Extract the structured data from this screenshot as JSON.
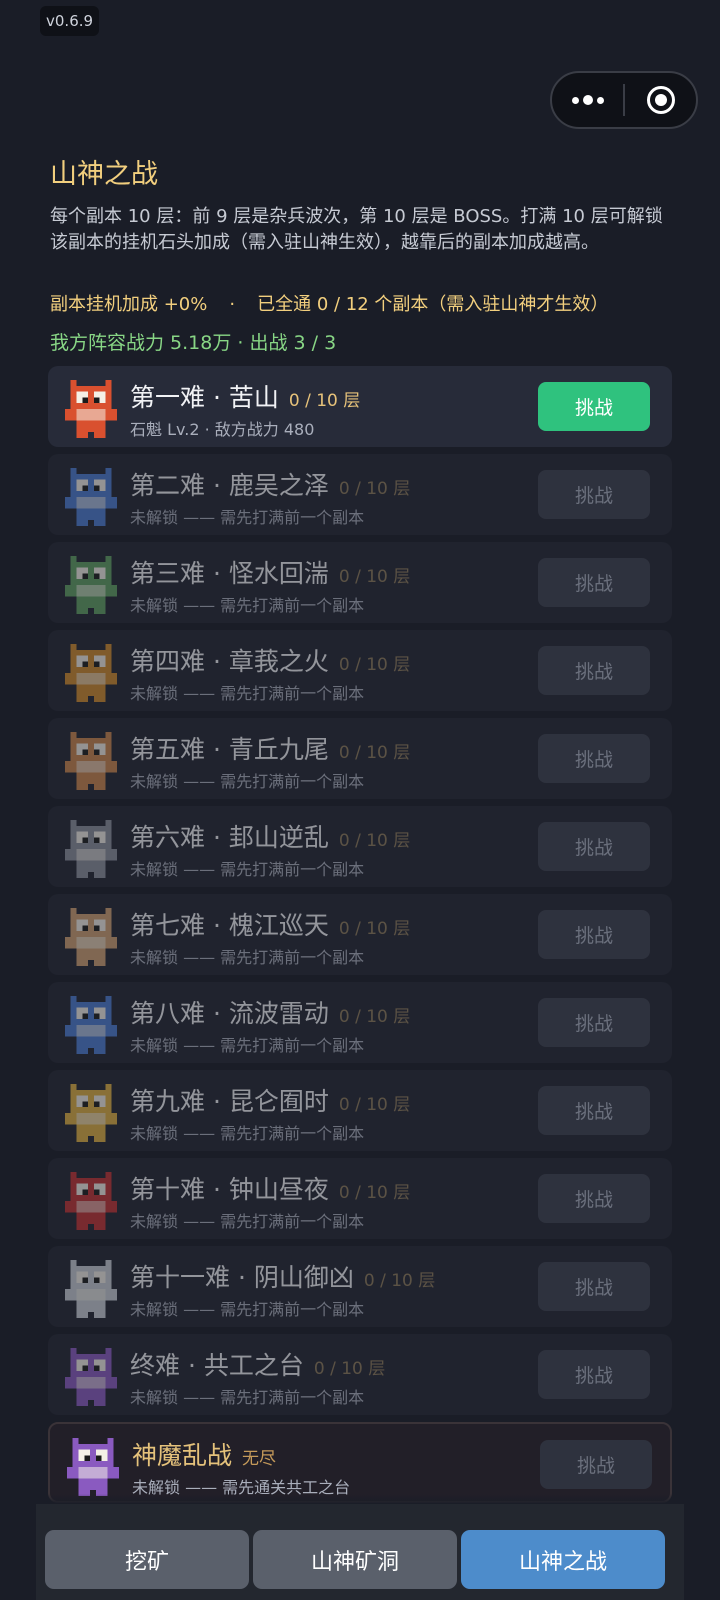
{
  "version": "v0.6.9",
  "capsule": {
    "menu_icon": "more-dots-icon",
    "close_icon": "target-circle-icon"
  },
  "header": {
    "title": "山神之战",
    "description": "每个副本 10 层：前 9 层是杂兵波次，第 10 层是 BOSS。打满 10 层可解锁该副本的挂机石头加成（需入驻山神生效），越靠后的副本加成越高。",
    "bonus_left": "副本挂机加成 +0%",
    "bonus_dot": "·",
    "bonus_right": "已全通 0 / 12 个副本（需入驻山神才生效）",
    "power": "我方阵容战力 5.18万 · 出战 3 / 3"
  },
  "colors": {
    "accent_green": "#2fc27e",
    "gold": "#f2cf7e",
    "power_green": "#88d685",
    "tab_selected": "#4d8ccb"
  },
  "stages": [
    {
      "name": "第一难 · 苦山",
      "floors": "0 / 10 层",
      "sub": "石魁 Lv.2 · 敌方战力 480",
      "button": "挑战",
      "state": "active",
      "sprite_color": "#d9502f"
    },
    {
      "name": "第二难 · 鹿吴之泽",
      "floors": "0 / 10 层",
      "sub": "未解锁 —— 需先打满前一个副本",
      "button": "挑战",
      "state": "locked",
      "sprite_color": "#4a7bd0"
    },
    {
      "name": "第三难 · 怪水回湍",
      "floors": "0 / 10 层",
      "sub": "未解锁 —— 需先打满前一个副本",
      "button": "挑战",
      "state": "locked",
      "sprite_color": "#5fa060"
    },
    {
      "name": "第四难 · 章莪之火",
      "floors": "0 / 10 层",
      "sub": "未解锁 —— 需先打满前一个副本",
      "button": "挑战",
      "state": "locked",
      "sprite_color": "#d08a2a"
    },
    {
      "name": "第五难 · 青丘九尾",
      "floors": "0 / 10 层",
      "sub": "未解锁 —— 需先打满前一个副本",
      "button": "挑战",
      "state": "locked",
      "sprite_color": "#c9844a"
    },
    {
      "name": "第六难 · 邽山逆乱",
      "floors": "0 / 10 层",
      "sub": "未解锁 —— 需先打满前一个副本",
      "button": "挑战",
      "state": "locked",
      "sprite_color": "#8a8f9a"
    },
    {
      "name": "第七难 · 槐江巡天",
      "floors": "0 / 10 层",
      "sub": "未解锁 —— 需先打满前一个副本",
      "button": "挑战",
      "state": "locked",
      "sprite_color": "#d0a070"
    },
    {
      "name": "第八难 · 流波雷动",
      "floors": "0 / 10 层",
      "sub": "未解锁 —— 需先打满前一个副本",
      "button": "挑战",
      "state": "locked",
      "sprite_color": "#4a7bd0"
    },
    {
      "name": "第九难 · 昆仑囿时",
      "floors": "0 / 10 层",
      "sub": "未解锁 —— 需先打满前一个副本",
      "button": "挑战",
      "state": "locked",
      "sprite_color": "#e0b040"
    },
    {
      "name": "第十难 · 钟山昼夜",
      "floors": "0 / 10 层",
      "sub": "未解锁 —— 需先打满前一个副本",
      "button": "挑战",
      "state": "locked",
      "sprite_color": "#c03030"
    },
    {
      "name": "第十一难 · 阴山御凶",
      "floors": "0 / 10 层",
      "sub": "未解锁 —— 需先打满前一个副本",
      "button": "挑战",
      "state": "locked",
      "sprite_color": "#c8ccd4"
    },
    {
      "name": "终难 · 共工之台",
      "floors": "0 / 10 层",
      "sub": "未解锁 —— 需先打满前一个副本",
      "button": "挑战",
      "state": "locked",
      "sprite_color": "#8a5ac0"
    },
    {
      "name": "神魔乱战",
      "floors": "无尽",
      "sub": "未解锁 —— 需先通关共工之台",
      "button": "挑战",
      "state": "endless",
      "sprite_color": "#8a5ac0"
    }
  ],
  "tabs": [
    {
      "label": "挖矿",
      "selected": false
    },
    {
      "label": "山神矿洞",
      "selected": false
    },
    {
      "label": "山神之战",
      "selected": true
    }
  ]
}
